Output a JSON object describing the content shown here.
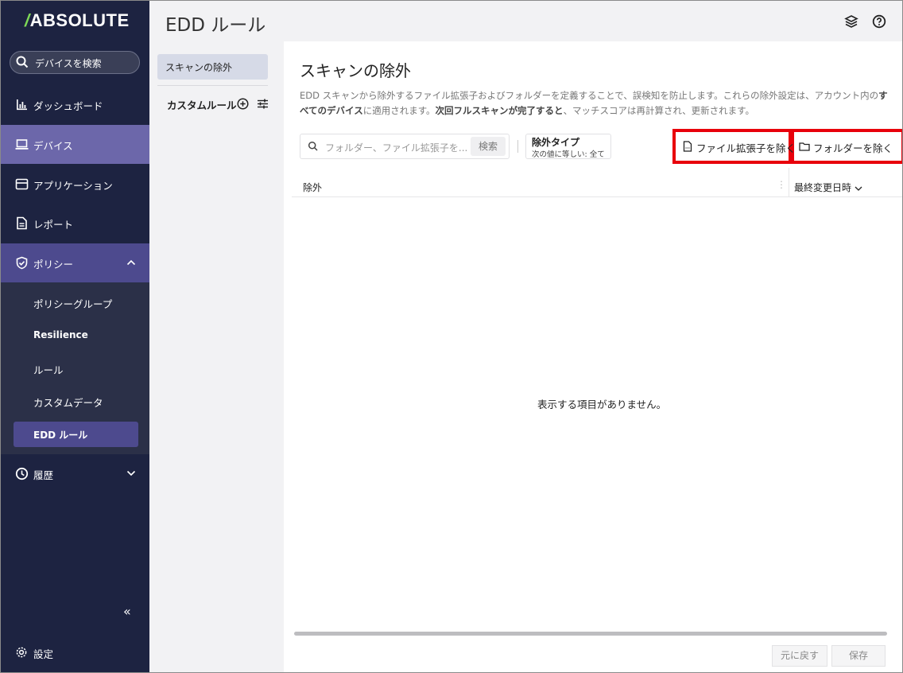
{
  "brand": {
    "logo_slash": "/",
    "logo_text": "ABSOLUTE"
  },
  "search": {
    "label": "デバイスを検索"
  },
  "nav": {
    "dashboard": "ダッシュボード",
    "devices": "デバイス",
    "applications": "アプリケーション",
    "reports": "レポート",
    "policies": "ポリシー",
    "history": "履歴",
    "settings": "設定"
  },
  "policy_sub": [
    "ポリシーグループ",
    "Resilience",
    "ルール",
    "カスタムデータ",
    "EDD ルール"
  ],
  "page": {
    "title": "EDD ルール"
  },
  "subpanel": {
    "scan_exclusions": "スキャンの除外",
    "custom_rules": "カスタムルール"
  },
  "main": {
    "title": "スキャンの除外",
    "desc_1": "EDD スキャンから除外するファイル拡張子およびフォルダーを定義することで、誤検知を防止します。これらの除外設定は、アカウント内の",
    "desc_bold_1": "すべてのデバイス",
    "desc_2": "に適用されます。",
    "desc_bold_2": "次回フルスキャンが完了すると",
    "desc_3": "、マッチスコアは再計算され、更新されます。",
    "search_placeholder": "フォルダー、ファイル拡張子を...",
    "search_button": "検索",
    "filter_title": "除外タイプ",
    "filter_value": "次の値に等しい: 全て",
    "exclude_ext": "ファイル拡張子を除く",
    "exclude_folder": "フォルダーを除く",
    "col_exclusion": "除外",
    "col_modified": "最終変更日時",
    "empty": "表示する項目がありません。",
    "undo": "元に戻す",
    "save": "保存"
  },
  "colors": {
    "sidebar": "#1d2341",
    "active_item": "#4d4a8e",
    "highlight": "#e8000b",
    "logo_accent": "#7ed957"
  }
}
